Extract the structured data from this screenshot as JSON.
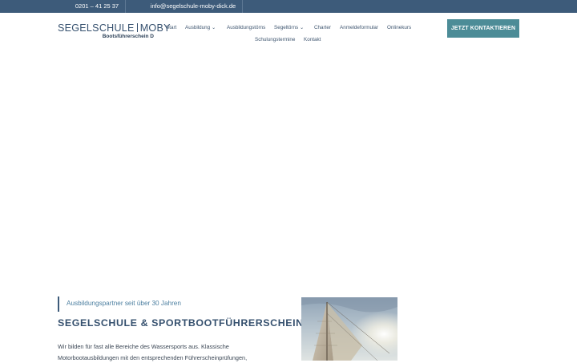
{
  "topbar": {
    "phone": "0201 – 41 25 37",
    "email": "info@segelschule-moby-dick.de"
  },
  "logo": {
    "left_text": "SEGELSCHULE",
    "right_text": "MOBY",
    "subtitle": "Bootsführerschein D"
  },
  "nav": {
    "items": [
      {
        "label": "Start"
      },
      {
        "label": "Ausbildung",
        "dropdown": true
      },
      {
        "label": "Ausbildungstörns"
      },
      {
        "label": "Segeltörns",
        "dropdown": true
      },
      {
        "label": "Charter"
      },
      {
        "label": "Anmeldeformular"
      },
      {
        "label": "Onlinekurs"
      },
      {
        "label": "Schulungstermine"
      },
      {
        "label": "Kontakt"
      }
    ],
    "cta_label": "JETZT KONTAKTIEREN"
  },
  "intro": {
    "eyebrow": "Ausbildungspartner seit über 30 Jahren",
    "headline": "SEGELSCHULE & SPORTBOOTFÜHRERSCHEINE",
    "body_line1": "Wir bilden für fast alle Bereiche des Wassersports aus. Klassische",
    "body_line2": "Motorbootausbildungen mit den entsprechenden Führerscheinprüfungen,"
  },
  "colors": {
    "topbar": "#3d5b7a",
    "brand": "#35506e",
    "accent": "#4c8c97",
    "eyebrow": "#4c7fa0"
  },
  "icons": {
    "dropdown": "chevron-down-icon"
  }
}
